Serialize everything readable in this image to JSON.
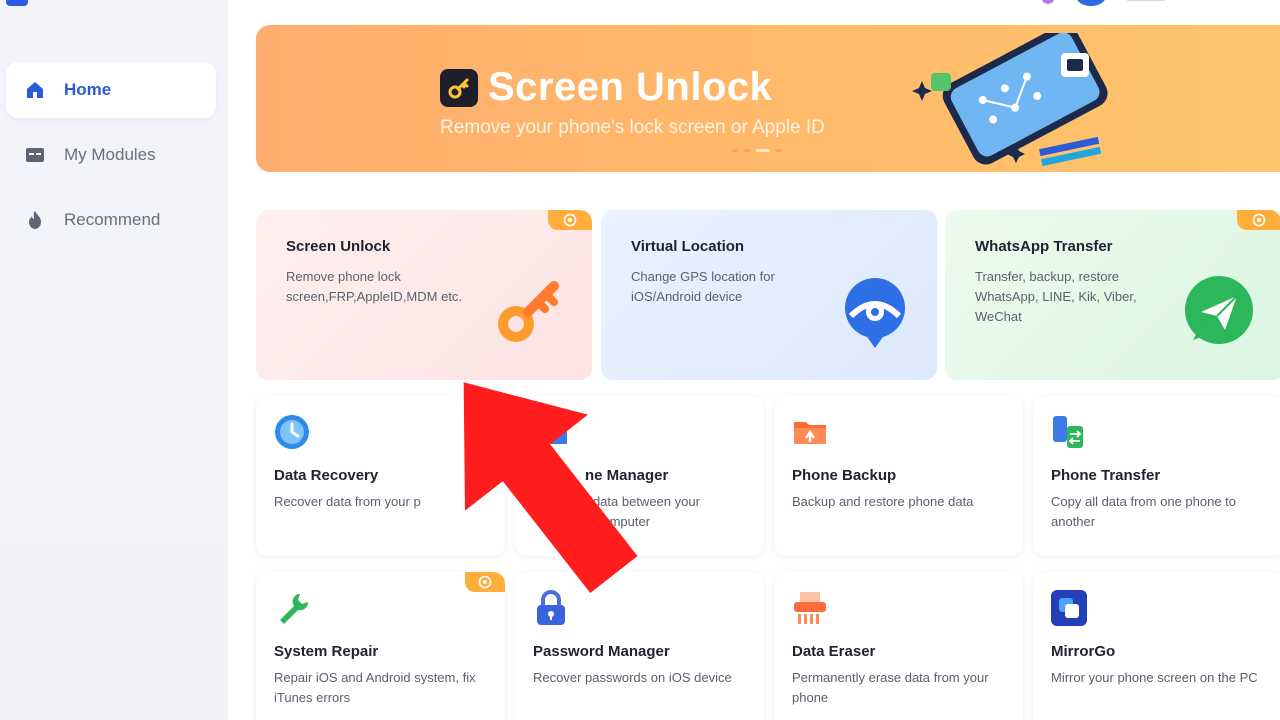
{
  "sidebar": {
    "items": [
      {
        "label": "Home",
        "icon": "home-icon",
        "active": true
      },
      {
        "label": "My Modules",
        "icon": "modules-icon",
        "active": false
      },
      {
        "label": "Recommend",
        "icon": "fire-icon",
        "active": false
      }
    ]
  },
  "banner": {
    "title": "Screen Unlock",
    "subtitle": "Remove your phone's lock screen or Apple ID"
  },
  "feature_cards": [
    {
      "title": "Screen Unlock",
      "desc": "Remove phone lock screen,FRP,AppleID,MDM etc.",
      "icon": "key-icon",
      "color": "#ff8a2a"
    },
    {
      "title": "Virtual Location",
      "desc": "Change GPS location for iOS/Android device",
      "icon": "location-pin-icon",
      "color": "#3a7be8"
    },
    {
      "title": "WhatsApp Transfer",
      "desc": "Transfer, backup, restore WhatsApp, LINE, Kik, Viber, WeChat",
      "icon": "send-icon",
      "color": "#2cb75a"
    }
  ],
  "modules": [
    {
      "title": "Data Recovery",
      "desc": "Recover data from your p",
      "icon": "clock-icon"
    },
    {
      "title": "ne Manager",
      "desc": "r data between your\nd computer",
      "icon": "folder-icon"
    },
    {
      "title": "Phone Backup",
      "desc": "Backup and restore phone data",
      "icon": "backup-folder-icon"
    },
    {
      "title": "Phone Transfer",
      "desc": "Copy all data from one phone to another",
      "icon": "transfer-icon"
    },
    {
      "title": "System Repair",
      "desc": "Repair iOS and Android system, fix iTunes errors",
      "icon": "wrench-icon"
    },
    {
      "title": "Password Manager",
      "desc": "Recover passwords on iOS device",
      "icon": "lock-icon"
    },
    {
      "title": "Data Eraser",
      "desc": "Permanently erase data from your phone",
      "icon": "shredder-icon"
    },
    {
      "title": "MirrorGo",
      "desc": "Mirror your phone screen on the PC",
      "icon": "mirror-icon"
    }
  ],
  "colors": {
    "accent": "#2a5bd7",
    "badge": "#ffae3c",
    "arrow": "#ff1d1d"
  }
}
